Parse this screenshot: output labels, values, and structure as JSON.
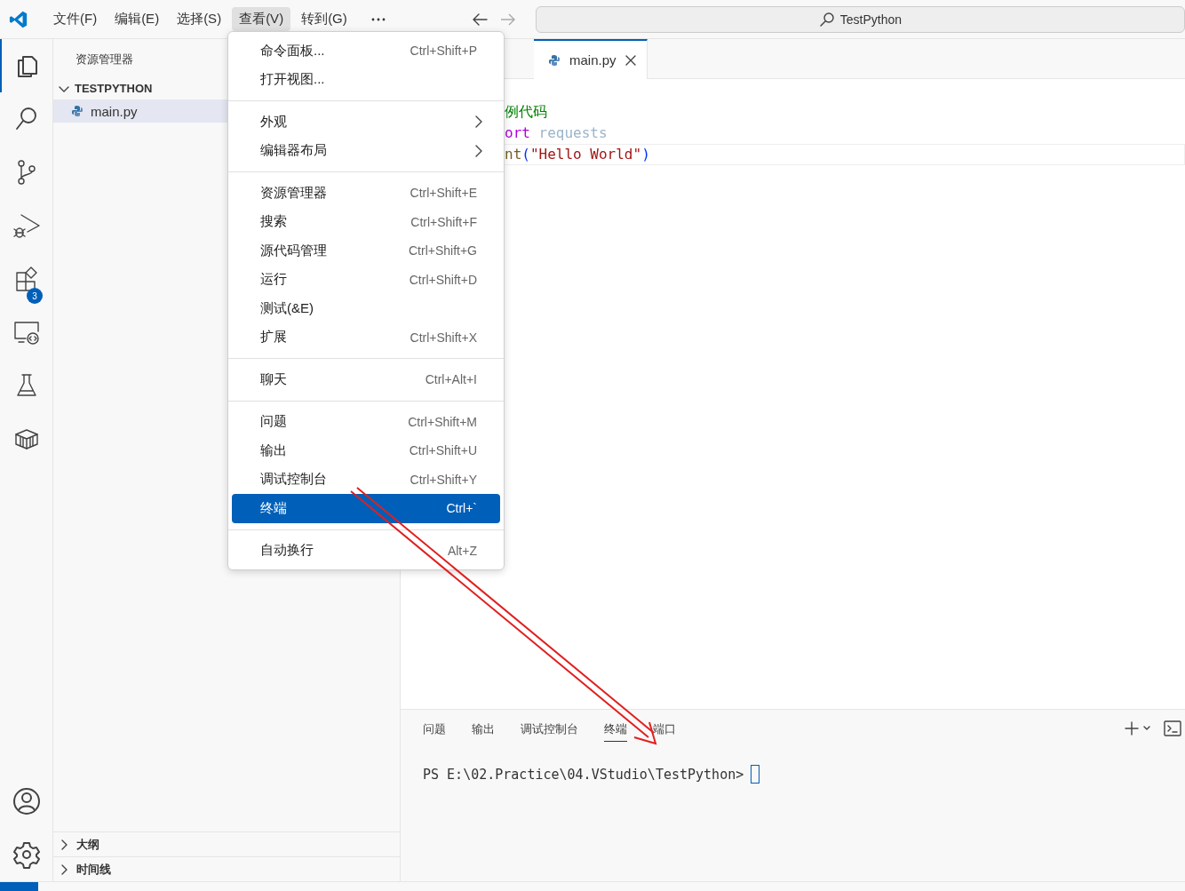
{
  "menubar": {
    "items": [
      {
        "label": "文件(F)",
        "selected": false
      },
      {
        "label": "编辑(E)",
        "selected": false
      },
      {
        "label": "选择(S)",
        "selected": false
      },
      {
        "label": "查看(V)",
        "selected": true
      },
      {
        "label": "转到(G)",
        "selected": false
      }
    ]
  },
  "command_center": {
    "text": "TestPython"
  },
  "activity_bar": {
    "items": [
      {
        "kind": "explorer",
        "selected": true
      },
      {
        "kind": "search",
        "selected": false
      },
      {
        "kind": "source-control",
        "selected": false
      },
      {
        "kind": "run-debug",
        "selected": false
      },
      {
        "kind": "extensions",
        "selected": false,
        "badge": "3"
      },
      {
        "kind": "remote",
        "selected": false
      },
      {
        "kind": "testing",
        "selected": false
      },
      {
        "kind": "containers",
        "selected": false
      }
    ]
  },
  "sidebar": {
    "title": "资源管理器",
    "folder": {
      "label": "TESTPYTHON",
      "expanded": true,
      "children": [
        {
          "label": "main.py",
          "selected": true
        }
      ]
    },
    "sections": [
      {
        "label": "大纲",
        "expanded": false
      },
      {
        "label": "时间线",
        "expanded": false
      }
    ]
  },
  "editor": {
    "tabs": [
      {
        "label": "main.py",
        "selected": true
      }
    ],
    "lines": [
      {
        "current": false,
        "tokens": [
          {
            "text": "例代码",
            "kind": "comment"
          }
        ]
      },
      {
        "current": false,
        "tokens": [
          {
            "text": "ort",
            "kind": "keyword"
          },
          {
            "text": " requests",
            "kind": "module"
          }
        ]
      },
      {
        "current": true,
        "tokens": [
          {
            "text": "nt",
            "kind": "function"
          },
          {
            "text": "(",
            "kind": "bracket"
          },
          {
            "text": "\"Hello World\"",
            "kind": "string"
          },
          {
            "text": ")",
            "kind": "bracket"
          }
        ]
      }
    ]
  },
  "panel": {
    "tabs": [
      {
        "label": "问题",
        "selected": false
      },
      {
        "label": "输出",
        "selected": false
      },
      {
        "label": "调试控制台",
        "selected": false
      },
      {
        "label": "终端",
        "selected": true
      },
      {
        "label": "端口",
        "selected": false
      }
    ],
    "terminal": {
      "prompt": "PS E:\\02.Practice\\04.VStudio\\TestPython>"
    }
  },
  "view_menu": {
    "groups": [
      [
        {
          "label": "命令面板...",
          "shortcut": "Ctrl+Shift+P",
          "submenu": false,
          "selected": false
        },
        {
          "label": "打开视图...",
          "submenu": false,
          "selected": false
        }
      ],
      [
        {
          "label": "外观",
          "submenu": true,
          "selected": false
        },
        {
          "label": "编辑器布局",
          "submenu": true,
          "selected": false
        }
      ],
      [
        {
          "label": "资源管理器",
          "shortcut": "Ctrl+Shift+E",
          "submenu": false,
          "selected": false
        },
        {
          "label": "搜索",
          "shortcut": "Ctrl+Shift+F",
          "submenu": false,
          "selected": false
        },
        {
          "label": "源代码管理",
          "shortcut": "Ctrl+Shift+G",
          "submenu": false,
          "selected": false
        },
        {
          "label": "运行",
          "shortcut": "Ctrl+Shift+D",
          "submenu": false,
          "selected": false
        },
        {
          "label": "测试(&E)",
          "submenu": false,
          "selected": false
        },
        {
          "label": "扩展",
          "shortcut": "Ctrl+Shift+X",
          "submenu": false,
          "selected": false
        }
      ],
      [
        {
          "label": "聊天",
          "shortcut": "Ctrl+Alt+I",
          "submenu": false,
          "selected": false
        }
      ],
      [
        {
          "label": "问题",
          "shortcut": "Ctrl+Shift+M",
          "submenu": false,
          "selected": false
        },
        {
          "label": "输出",
          "shortcut": "Ctrl+Shift+U",
          "submenu": false,
          "selected": false
        },
        {
          "label": "调试控制台",
          "shortcut": "Ctrl+Shift+Y",
          "submenu": false,
          "selected": false
        },
        {
          "label": "终端",
          "shortcut": "Ctrl+`",
          "submenu": false,
          "selected": true
        }
      ],
      [
        {
          "label": "自动换行",
          "shortcut": "Alt+Z",
          "submenu": false,
          "selected": false
        }
      ]
    ]
  }
}
